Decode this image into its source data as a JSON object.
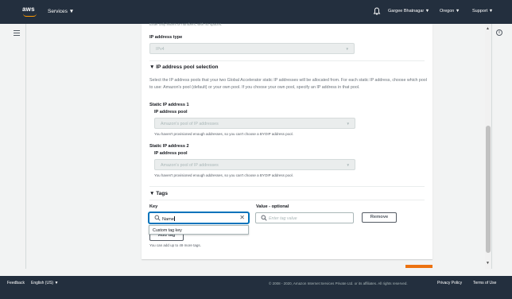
{
  "nav": {
    "logo": "aws",
    "services": "Services ▼",
    "user": "Gargee Bhatnagar ▼",
    "region": "Oregon ▼",
    "support": "Support ▼"
  },
  "form": {
    "cut_hint": "Enter only letters or numbers, with no spaces.",
    "ip_type_label": "IP address type",
    "ip_type_value": "IPv4",
    "pool_section_title": "IP address pool selection",
    "pool_description": "Select the IP address pools that your two Global Accelerator static IP addresses will be allocated from. For each static IP address, choose which pool to use: Amazon's pool (default) or your own pool. If you choose your own pool, specify an IP address in that pool.",
    "static1_label": "Static IP address 1",
    "static2_label": "Static IP address 2",
    "pool_label": "IP address pool",
    "pool_value": "Amazon's pool of IP addresses",
    "pool_hint": "You haven't provisioned enough addresses, so you can't choose a BYOIP address pool.",
    "tags_title": "Tags",
    "key_label": "Key",
    "value_label": "Value - optional",
    "key_value": "Name",
    "value_placeholder": "Enter tag value",
    "remove_button": "Remove",
    "dropdown_option": "Custom tag key",
    "add_tag_button": "Add tag",
    "tags_hint": "You can add up to 49 more tags."
  },
  "footer": {
    "feedback": "Feedback",
    "language": "English (US) ▼",
    "copyright": "© 2008 - 2020, Amazon Internet Services Private Ltd. or its affiliates. All rights reserved.",
    "privacy": "Privacy Policy",
    "terms": "Terms of Use"
  },
  "colors": {
    "nav_bg": "#232f3e",
    "accent_orange": "#ec7211",
    "focus_blue": "#0073bb"
  },
  "icons": [
    "hamburger-icon",
    "bell-icon",
    "info-icon",
    "search-icon",
    "clear-icon",
    "caret-down-icon"
  ]
}
